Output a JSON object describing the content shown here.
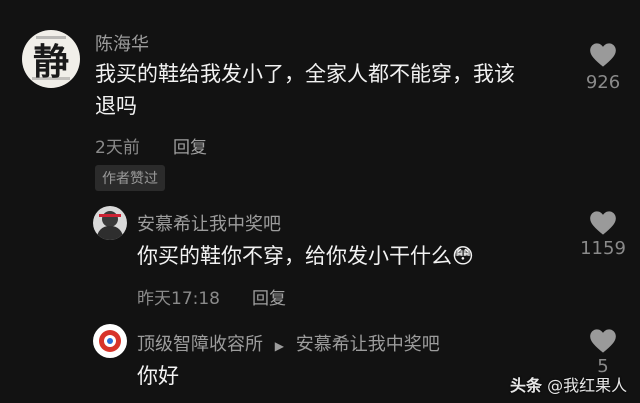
{
  "comments": [
    {
      "author": "陈海华",
      "avatar_text": "静",
      "text_line1": "我买的鞋给我发小了，全家人都不能穿，我该",
      "text_line2": "退吗",
      "time": "2天前",
      "reply": "回复",
      "likes": "926",
      "badge": "作者赞过"
    },
    {
      "author": "安慕希让我中奖吧",
      "text": "你买的鞋你不穿，给你发小干什么",
      "emoji": "😳",
      "time": "昨天17:18",
      "reply": "回复",
      "likes": "1159"
    },
    {
      "author": "顶级智障收容所",
      "reply_to": "安慕希让我中奖吧",
      "text": "你好",
      "likes": "5"
    }
  ],
  "watermark": {
    "brand": "头条",
    "handle": "@我红果人"
  },
  "colors": {
    "background": "#121212",
    "text": "#f2f2f2",
    "secondary": "#8a8a8a"
  }
}
